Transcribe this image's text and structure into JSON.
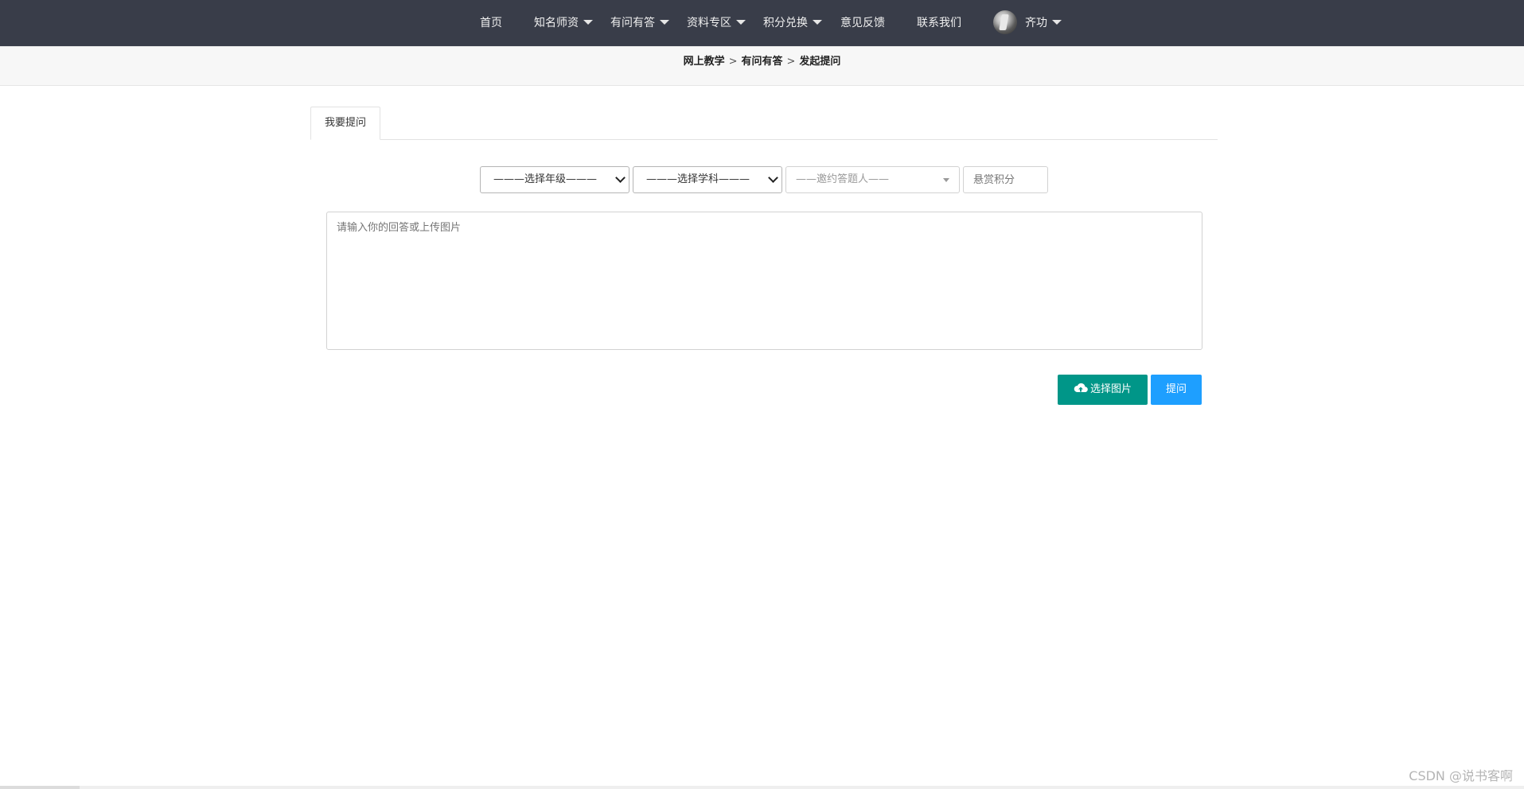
{
  "nav": {
    "items": [
      {
        "label": "首页",
        "has_dropdown": false
      },
      {
        "label": "知名师资",
        "has_dropdown": true
      },
      {
        "label": "有问有答",
        "has_dropdown": true
      },
      {
        "label": "资料专区",
        "has_dropdown": true
      },
      {
        "label": "积分兑换",
        "has_dropdown": true
      },
      {
        "label": "意见反馈",
        "has_dropdown": false
      },
      {
        "label": "联系我们",
        "has_dropdown": false
      }
    ],
    "user": {
      "name": "齐功",
      "has_dropdown": true
    },
    "background": "#393d49"
  },
  "breadcrumb": {
    "items": [
      "网上教学",
      "有问有答",
      "发起提问"
    ],
    "separator": ">"
  },
  "tabs": [
    {
      "label": "我要提问",
      "active": true
    }
  ],
  "form": {
    "grade_select": {
      "selected": "———选择年级———"
    },
    "subject_select": {
      "selected": "———选择学科———"
    },
    "invite_select": {
      "placeholder": "——邀约答题人——"
    },
    "points_input": {
      "placeholder": "悬赏积分",
      "value": ""
    },
    "question_textarea": {
      "placeholder": "请输入你的回答或上传图片",
      "value": ""
    },
    "upload_button": {
      "label": "选择图片",
      "icon": "cloud-upload-icon",
      "color": "#009688"
    },
    "submit_button": {
      "label": "提问",
      "color": "#1e9fff"
    }
  },
  "watermark": "CSDN @说书客啊"
}
